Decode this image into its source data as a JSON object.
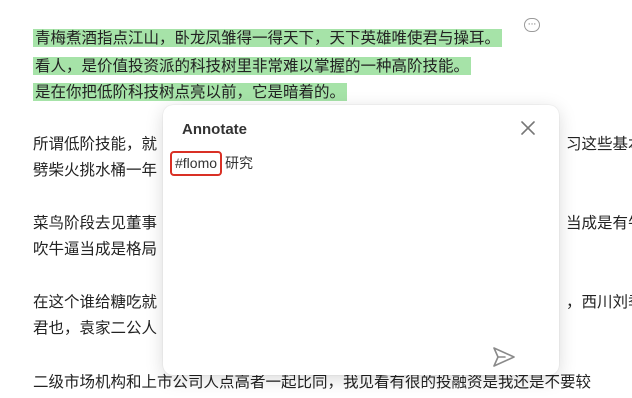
{
  "article": {
    "highlighted_lines": [
      "青梅煮酒指点江山，卧龙凤雏得一得天下，天下英雄唯使君与操耳。",
      "看人，是价值投资派的科技树里非常难以掌握的一种高阶技能。",
      "是在你把低阶科技树点亮以前，它是暗着的。"
    ],
    "paragraphs": [
      [
        "所谓低阶技能，就",
        "习这些基本"
      ],
      [
        "劈柴火挑水桶一年"
      ],
      [
        "菜鸟阶段去见董事",
        "当成是有牛"
      ],
      [
        "吹牛逼当成是格局"
      ],
      [
        "在这个谁给糖吃就",
        "，西川刘季"
      ],
      [
        "君也，袁家二公人"
      ],
      [
        "二级市场机构和上市公司人点高者一起比同，我见看有很的投融资是我还是不要较"
      ]
    ],
    "comment_icon": "ellipsis-comment-icon"
  },
  "annotate_popup": {
    "title": "Annotate",
    "tag": "#flomo",
    "note_text": "研究",
    "close_icon": "close-icon",
    "send_icon": "send-icon",
    "tag_outline_color": "#d93025",
    "highlight_color": "#a6e3a8"
  }
}
